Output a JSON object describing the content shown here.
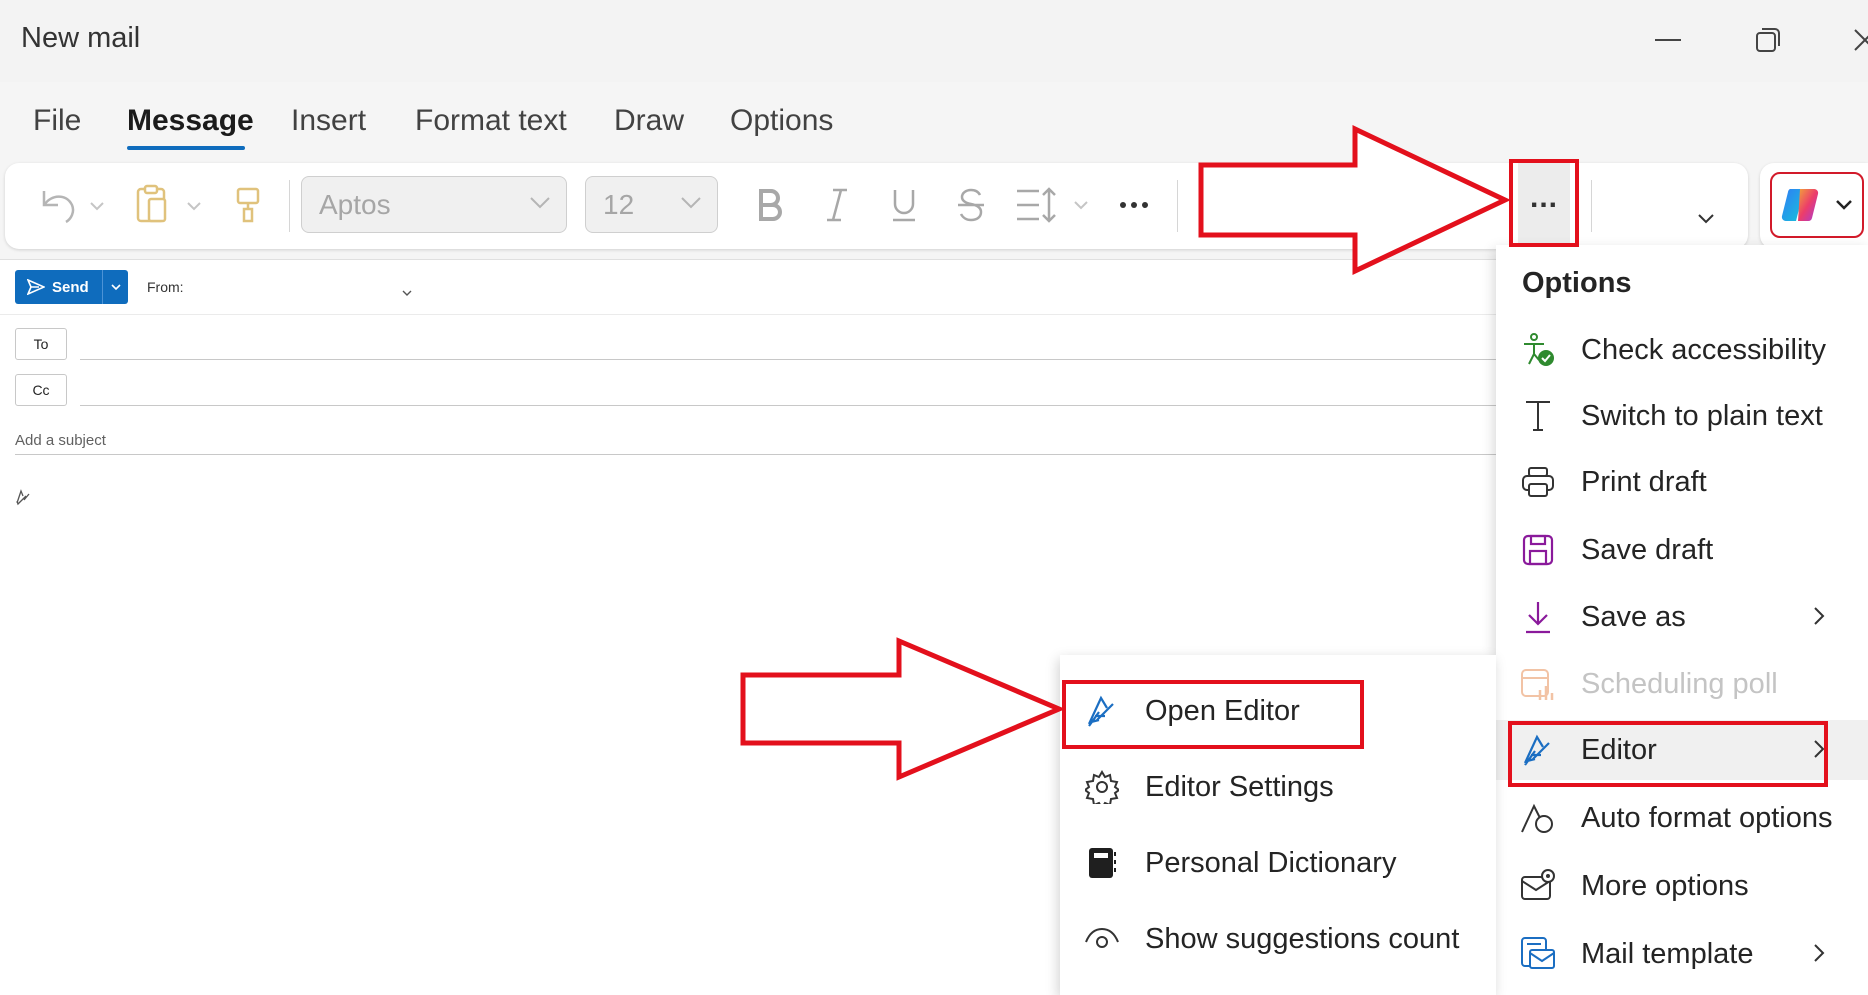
{
  "window": {
    "title": "New mail"
  },
  "tabs": [
    {
      "label": "File"
    },
    {
      "label": "Message"
    },
    {
      "label": "Insert"
    },
    {
      "label": "Format text"
    },
    {
      "label": "Draw"
    },
    {
      "label": "Options"
    }
  ],
  "ribbon": {
    "font_name": "Aptos",
    "font_size": "12",
    "more_label": "..."
  },
  "compose": {
    "send_label": "Send",
    "from_label": "From:",
    "to_label": "To",
    "cc_label": "Cc",
    "subject_placeholder": "Add a subject"
  },
  "options_menu": {
    "title": "Options",
    "items": [
      {
        "label": "Check accessibility",
        "icon": "accessibility-check-icon"
      },
      {
        "label": "Switch to plain text",
        "icon": "text-t-icon"
      },
      {
        "label": "Print draft",
        "icon": "printer-icon"
      },
      {
        "label": "Save draft",
        "icon": "save-disk-icon"
      },
      {
        "label": "Save as",
        "icon": "download-arrow-icon",
        "submenu": true
      },
      {
        "label": "Scheduling poll",
        "icon": "scheduling-poll-icon",
        "disabled": true
      },
      {
        "label": "Editor",
        "icon": "editor-pen-icon",
        "submenu": true
      },
      {
        "label": "Auto format options",
        "icon": "auto-format-icon"
      },
      {
        "label": "More options",
        "icon": "mail-settings-icon"
      },
      {
        "label": "Mail template",
        "icon": "mail-template-icon",
        "submenu": true
      }
    ]
  },
  "editor_submenu": {
    "items": [
      {
        "label": "Open Editor",
        "icon": "editor-pen-icon"
      },
      {
        "label": "Editor Settings",
        "icon": "gear-icon"
      },
      {
        "label": "Personal Dictionary",
        "icon": "dictionary-book-icon"
      },
      {
        "label": "Show suggestions count",
        "icon": "eye-icon"
      }
    ]
  },
  "colors": {
    "accent": "#0f6cbd",
    "annotation_red": "#e3101c",
    "save_purple": "#8a1a9b",
    "editor_blue": "#1b6ec2",
    "accessibility_green": "#2f8a2f"
  }
}
